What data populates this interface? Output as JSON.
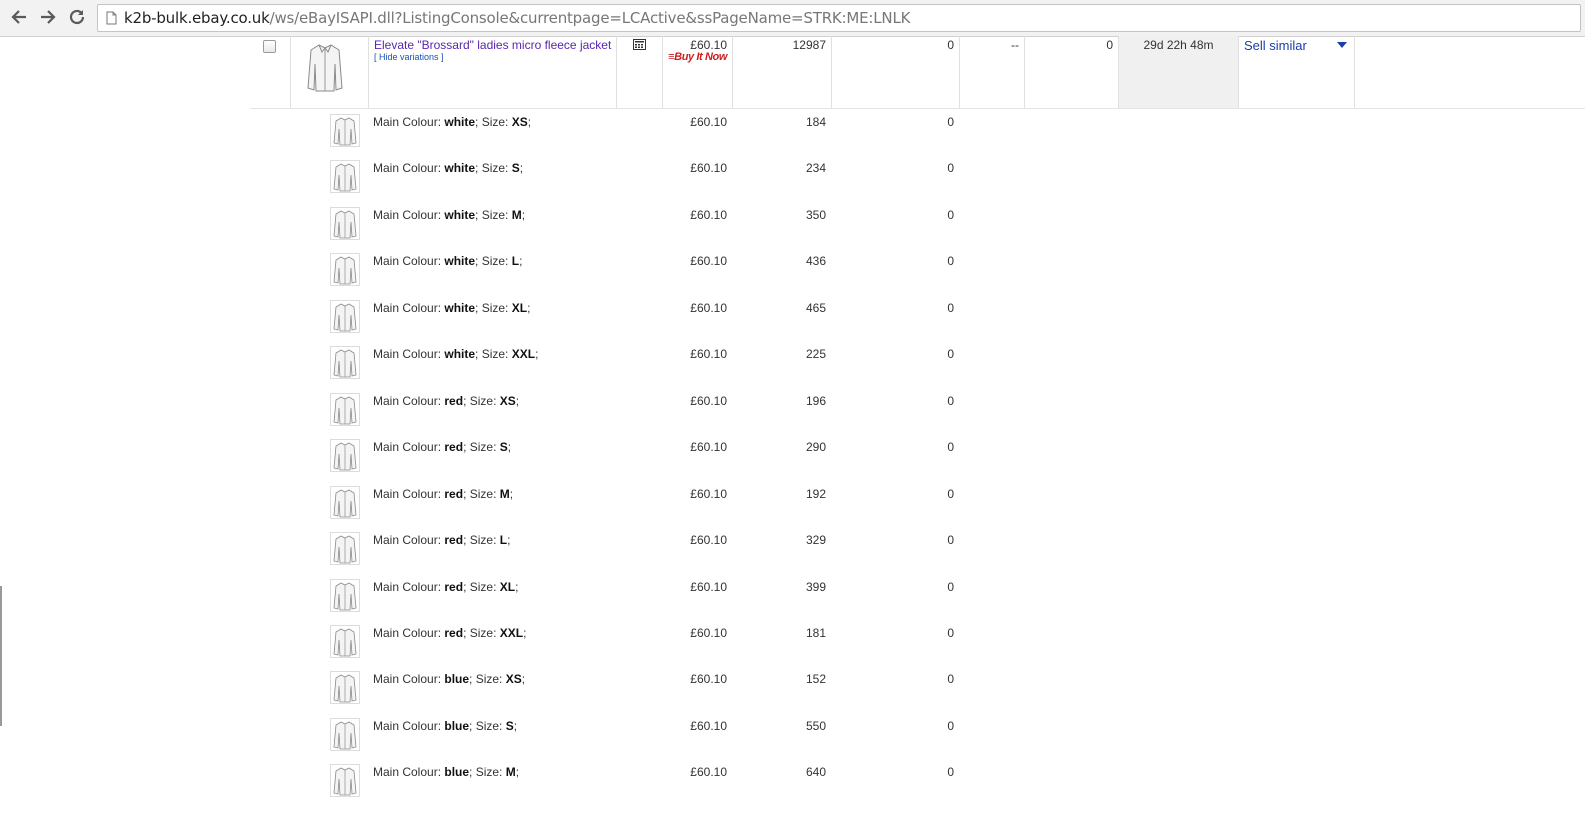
{
  "browser": {
    "url_host": "k2b-bulk.ebay.co.uk",
    "url_path": "/ws/eBayISAPI.dll?ListingConsole&currentpage=LCActive&ssPageName=STRK:ME:LNLK"
  },
  "listing": {
    "title": "Elevate \"Brossard\" ladies micro fleece jacket",
    "hide_variations": "[ Hide variations ]",
    "price": "£60.10",
    "buy_it_now": "Buy It Now",
    "quantity": "12987",
    "sold": "0",
    "dash": "--",
    "watchers": "0",
    "time_left": "29d 22h 48m",
    "action": "Sell similar"
  },
  "variations": [
    {
      "colour_label": "Main Colour:",
      "colour": "white",
      "size_label": "; Size:",
      "size": "XS",
      "end": ";",
      "price": "£60.10",
      "quantity": "184",
      "sold": "0"
    },
    {
      "colour_label": "Main Colour:",
      "colour": "white",
      "size_label": "; Size:",
      "size": "S",
      "end": ";",
      "price": "£60.10",
      "quantity": "234",
      "sold": "0"
    },
    {
      "colour_label": "Main Colour:",
      "colour": "white",
      "size_label": "; Size:",
      "size": "M",
      "end": ";",
      "price": "£60.10",
      "quantity": "350",
      "sold": "0"
    },
    {
      "colour_label": "Main Colour:",
      "colour": "white",
      "size_label": "; Size:",
      "size": "L",
      "end": ";",
      "price": "£60.10",
      "quantity": "436",
      "sold": "0"
    },
    {
      "colour_label": "Main Colour:",
      "colour": "white",
      "size_label": "; Size:",
      "size": "XL",
      "end": ";",
      "price": "£60.10",
      "quantity": "465",
      "sold": "0"
    },
    {
      "colour_label": "Main Colour:",
      "colour": "white",
      "size_label": "; Size:",
      "size": "XXL",
      "end": ";",
      "price": "£60.10",
      "quantity": "225",
      "sold": "0"
    },
    {
      "colour_label": "Main Colour:",
      "colour": "red",
      "size_label": "; Size:",
      "size": "XS",
      "end": ";",
      "price": "£60.10",
      "quantity": "196",
      "sold": "0"
    },
    {
      "colour_label": "Main Colour:",
      "colour": "red",
      "size_label": "; Size:",
      "size": "S",
      "end": ";",
      "price": "£60.10",
      "quantity": "290",
      "sold": "0"
    },
    {
      "colour_label": "Main Colour:",
      "colour": "red",
      "size_label": "; Size:",
      "size": "M",
      "end": ";",
      "price": "£60.10",
      "quantity": "192",
      "sold": "0"
    },
    {
      "colour_label": "Main Colour:",
      "colour": "red",
      "size_label": "; Size:",
      "size": "L",
      "end": ";",
      "price": "£60.10",
      "quantity": "329",
      "sold": "0"
    },
    {
      "colour_label": "Main Colour:",
      "colour": "red",
      "size_label": "; Size:",
      "size": "XL",
      "end": ";",
      "price": "£60.10",
      "quantity": "399",
      "sold": "0"
    },
    {
      "colour_label": "Main Colour:",
      "colour": "red",
      "size_label": "; Size:",
      "size": "XXL",
      "end": ";",
      "price": "£60.10",
      "quantity": "181",
      "sold": "0"
    },
    {
      "colour_label": "Main Colour:",
      "colour": "blue",
      "size_label": "; Size:",
      "size": "XS",
      "end": ";",
      "price": "£60.10",
      "quantity": "152",
      "sold": "0"
    },
    {
      "colour_label": "Main Colour:",
      "colour": "blue",
      "size_label": "; Size:",
      "size": "S",
      "end": ";",
      "price": "£60.10",
      "quantity": "550",
      "sold": "0"
    },
    {
      "colour_label": "Main Colour:",
      "colour": "blue",
      "size_label": "; Size:",
      "size": "M",
      "end": ";",
      "price": "£60.10",
      "quantity": "640",
      "sold": "0"
    }
  ],
  "colors": {
    "title_link": "#5a26b0",
    "action_link": "#1a3ea8",
    "buy_it_now": "#cc1f1f",
    "time_cell_bg": "#f0f0f0"
  },
  "icons": {
    "back": "back-arrow-icon",
    "forward": "forward-arrow-icon",
    "reload": "reload-icon",
    "page": "page-icon",
    "format": "listing-format-icon",
    "dropdown": "chevron-down-icon",
    "thumbnail": "jacket-thumbnail"
  }
}
